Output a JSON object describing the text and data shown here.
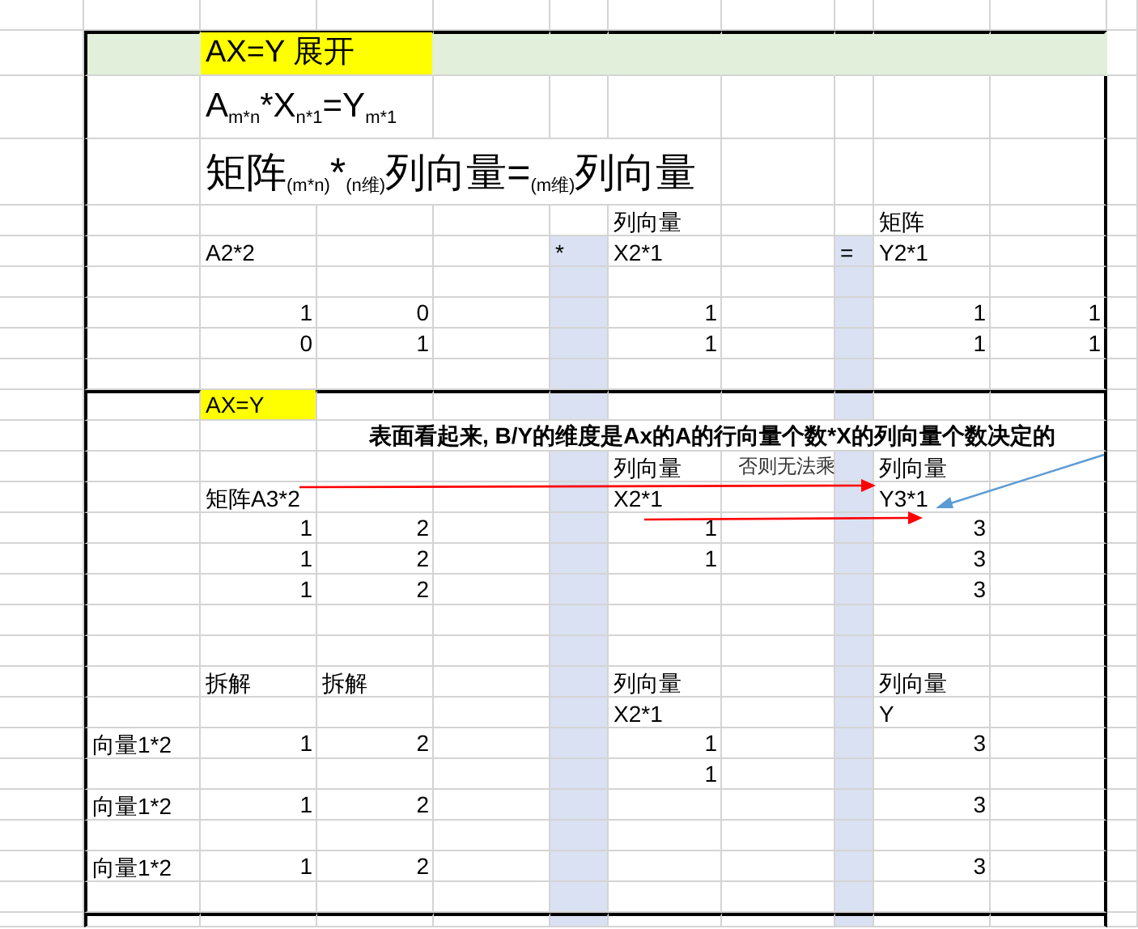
{
  "rows": [
    {
      "kind": "plain",
      "section_start": false
    },
    {
      "kind": "banner",
      "section_start": true,
      "cells": {
        "C": {
          "kind": "title",
          "text": "AX=Y 展开",
          "highlight": true
        }
      }
    },
    {
      "kind": "formula",
      "section_start": false,
      "cells": {
        "C": {
          "kind": "formula",
          "text": "A$_{m*n}$*X$_{n*1}$=Y$_{m*1}$",
          "highlight": false
        }
      }
    },
    {
      "kind": "formula2",
      "section_start": false,
      "cells": {
        "C": {
          "kind": "formula2",
          "text": "矩阵$_{(m*n)}$*$_{(n维)}$列向量=$_{(m维)}$列向量",
          "highlight": false
        }
      }
    },
    {
      "kind": "plain",
      "section_start": false,
      "cells": {
        "G": {
          "kind": "text",
          "text": "列向量",
          "highlight": false
        },
        "J": {
          "kind": "text",
          "text": "矩阵",
          "highlight": false
        }
      }
    },
    {
      "kind": "plain",
      "section_start": false,
      "cells": {
        "C": {
          "kind": "text",
          "text": "A2*2",
          "highlight": false
        },
        "F": {
          "kind": "text",
          "text": "*",
          "highlight": false
        },
        "G": {
          "kind": "text",
          "text": "X2*1",
          "highlight": false
        },
        "I": {
          "kind": "text",
          "text": "=",
          "highlight": false
        },
        "J": {
          "kind": "text",
          "text": "Y2*1",
          "highlight": false
        }
      }
    },
    {
      "kind": "plain",
      "section_start": false
    },
    {
      "kind": "plain",
      "section_start": false,
      "cells": {
        "C": {
          "kind": "number",
          "text": "1",
          "highlight": false
        },
        "D": {
          "kind": "number",
          "text": "0",
          "highlight": false
        },
        "G": {
          "kind": "number",
          "text": "1",
          "highlight": false
        },
        "J": {
          "kind": "number",
          "text": "1",
          "highlight": false
        },
        "K": {
          "kind": "number",
          "text": "1",
          "highlight": false
        }
      }
    },
    {
      "kind": "plain",
      "section_start": false,
      "cells": {
        "C": {
          "kind": "number",
          "text": "0",
          "highlight": false
        },
        "D": {
          "kind": "number",
          "text": "1",
          "highlight": false
        },
        "G": {
          "kind": "number",
          "text": "1",
          "highlight": false
        },
        "J": {
          "kind": "number",
          "text": "1",
          "highlight": false
        },
        "K": {
          "kind": "number",
          "text": "1",
          "highlight": false
        }
      }
    },
    {
      "kind": "plain",
      "section_start": false
    },
    {
      "kind": "plain",
      "section_start": true,
      "cells": {
        "C": {
          "kind": "text",
          "text": "AX=Y",
          "highlight": true
        }
      }
    },
    {
      "kind": "plain",
      "section_start": false,
      "cells": {
        "D": {
          "kind": "note",
          "text": "表面看起来, B/Y的维度是Ax的A的行向量个数*X的列向量个数决定的",
          "highlight": false
        }
      }
    },
    {
      "kind": "plain",
      "section_start": false,
      "cells": {
        "G": {
          "kind": "text",
          "text": "列向量",
          "highlight": false
        },
        "H": {
          "kind": "small",
          "text": "否则无法乘",
          "highlight": false
        },
        "J": {
          "kind": "text",
          "text": "列向量",
          "highlight": false
        }
      }
    },
    {
      "kind": "plain",
      "section_start": false,
      "cells": {
        "C": {
          "kind": "text",
          "text": "矩阵A3*2",
          "highlight": false
        },
        "G": {
          "kind": "text",
          "text": "X2*1",
          "highlight": false
        },
        "J": {
          "kind": "text",
          "text": "Y3*1",
          "highlight": false
        }
      }
    },
    {
      "kind": "plain",
      "section_start": false,
      "cells": {
        "C": {
          "kind": "number",
          "text": "1",
          "highlight": false
        },
        "D": {
          "kind": "number",
          "text": "2",
          "highlight": false
        },
        "G": {
          "kind": "number",
          "text": "1",
          "highlight": false
        },
        "J": {
          "kind": "number",
          "text": "3",
          "highlight": false
        }
      }
    },
    {
      "kind": "plain",
      "section_start": false,
      "cells": {
        "C": {
          "kind": "number",
          "text": "1",
          "highlight": false
        },
        "D": {
          "kind": "number",
          "text": "2",
          "highlight": false
        },
        "G": {
          "kind": "number",
          "text": "1",
          "highlight": false
        },
        "J": {
          "kind": "number",
          "text": "3",
          "highlight": false
        }
      }
    },
    {
      "kind": "plain",
      "section_start": false,
      "cells": {
        "C": {
          "kind": "number",
          "text": "1",
          "highlight": false
        },
        "D": {
          "kind": "number",
          "text": "2",
          "highlight": false
        },
        "J": {
          "kind": "number",
          "text": "3",
          "highlight": false
        }
      }
    },
    {
      "kind": "plain",
      "section_start": false
    },
    {
      "kind": "plain",
      "section_start": false
    },
    {
      "kind": "plain",
      "section_start": false,
      "cells": {
        "C": {
          "kind": "text",
          "text": "拆解",
          "highlight": false
        },
        "D": {
          "kind": "text",
          "text": "拆解",
          "highlight": false
        },
        "G": {
          "kind": "text",
          "text": "列向量",
          "highlight": false
        },
        "J": {
          "kind": "text",
          "text": "列向量",
          "highlight": false
        }
      }
    },
    {
      "kind": "plain",
      "section_start": false,
      "cells": {
        "G": {
          "kind": "text",
          "text": "X2*1",
          "highlight": false
        },
        "J": {
          "kind": "text",
          "text": "Y",
          "highlight": false
        }
      }
    },
    {
      "kind": "plain",
      "section_start": false,
      "cells": {
        "B": {
          "kind": "text",
          "text": "向量1*2",
          "highlight": false
        },
        "C": {
          "kind": "number",
          "text": "1",
          "highlight": false
        },
        "D": {
          "kind": "number",
          "text": "2",
          "highlight": false
        },
        "G": {
          "kind": "number",
          "text": "1",
          "highlight": false
        },
        "J": {
          "kind": "number",
          "text": "3",
          "highlight": false
        }
      }
    },
    {
      "kind": "plain",
      "section_start": false,
      "cells": {
        "G": {
          "kind": "number",
          "text": "1",
          "highlight": false
        }
      }
    },
    {
      "kind": "plain",
      "section_start": false,
      "cells": {
        "B": {
          "kind": "text",
          "text": "向量1*2",
          "highlight": false
        },
        "C": {
          "kind": "number",
          "text": "1",
          "highlight": false
        },
        "D": {
          "kind": "number",
          "text": "2",
          "highlight": false
        },
        "J": {
          "kind": "number",
          "text": "3",
          "highlight": false
        }
      }
    },
    {
      "kind": "plain",
      "section_start": false
    },
    {
      "kind": "plain",
      "section_start": false,
      "cells": {
        "B": {
          "kind": "text",
          "text": "向量1*2",
          "highlight": false
        },
        "C": {
          "kind": "number",
          "text": "1",
          "highlight": false
        },
        "D": {
          "kind": "number",
          "text": "2",
          "highlight": false
        },
        "J": {
          "kind": "number",
          "text": "3",
          "highlight": false
        }
      }
    },
    {
      "kind": "plain",
      "section_start": false
    },
    {
      "kind": "tail",
      "section_start": true
    }
  ]
}
